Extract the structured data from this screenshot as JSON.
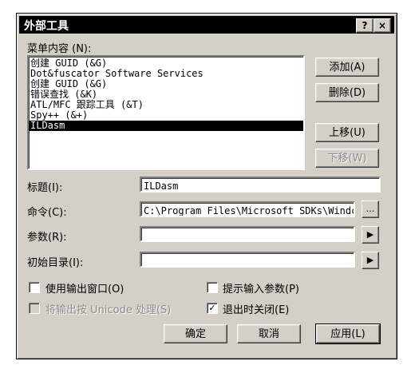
{
  "window": {
    "title": "外部工具",
    "help_glyph": "?",
    "close_glyph": "×"
  },
  "menu_contents_label": "菜单内容 (N):",
  "menu_items": [
    "创建 GUID (&G)",
    "Dot&fuscator Software Services",
    "创建 GUID (&G)",
    "错误查找 (&K)",
    "ATL/MFC 跟踪工具 (&T)",
    "Spy++ (&+)",
    "ILDasm"
  ],
  "selected_item_index": 6,
  "buttons": {
    "add": "添加(A)",
    "delete": "删除(D)",
    "move_up": "上移(U)",
    "move_down": "下移(W)",
    "ok": "确定",
    "cancel": "取消",
    "apply": "应用(L)"
  },
  "fields": {
    "title_label": "标题(I):",
    "title_value": "ILDasm",
    "command_label": "命令(C):",
    "command_value": "C:\\Program Files\\Microsoft SDKs\\Windc",
    "arguments_label": "参数(R):",
    "arguments_value": "",
    "initial_dir_label": "初始目录(I):",
    "initial_dir_value": "",
    "browse_glyph": "…",
    "arrow_glyph": "▶"
  },
  "options": {
    "use_output_window": {
      "label": "使用输出窗口(O)",
      "checked": false,
      "enabled": true
    },
    "prompt_arguments": {
      "label": "提示输入参数(P)",
      "checked": false,
      "enabled": true
    },
    "unicode_output": {
      "label": "将输出按 Unicode 处理(S)",
      "checked": false,
      "enabled": false
    },
    "close_on_exit": {
      "label": "退出时关闭(E)",
      "checked": true,
      "enabled": true
    }
  }
}
